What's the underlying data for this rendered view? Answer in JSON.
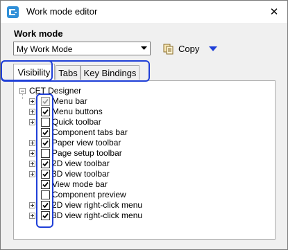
{
  "window": {
    "title": "Work mode editor",
    "close_glyph": "✕"
  },
  "work_mode": {
    "label": "Work mode",
    "selected": "My Work Mode",
    "copy_label": "Copy"
  },
  "tabs": [
    {
      "label": "Visibility",
      "active": true
    },
    {
      "label": "Tabs",
      "active": false
    },
    {
      "label": "Key Bindings",
      "active": false
    }
  ],
  "tree": {
    "root": "CET Designer",
    "items": [
      {
        "label": "Menu bar",
        "expander": true,
        "checked": true,
        "grayed": true
      },
      {
        "label": "Menu buttons",
        "expander": true,
        "checked": true,
        "grayed": false
      },
      {
        "label": "Quick toolbar",
        "expander": true,
        "checked": false,
        "grayed": false
      },
      {
        "label": "Component tabs bar",
        "expander": false,
        "checked": true,
        "grayed": false
      },
      {
        "label": "Paper view toolbar",
        "expander": true,
        "checked": true,
        "grayed": false
      },
      {
        "label": "Page setup toolbar",
        "expander": true,
        "checked": false,
        "grayed": false
      },
      {
        "label": "2D view toolbar",
        "expander": true,
        "checked": true,
        "grayed": false
      },
      {
        "label": "3D view toolbar",
        "expander": true,
        "checked": true,
        "grayed": false
      },
      {
        "label": "View mode bar",
        "expander": false,
        "checked": true,
        "grayed": false
      },
      {
        "label": "Component preview",
        "expander": false,
        "checked": false,
        "grayed": false
      },
      {
        "label": "2D view right-click menu",
        "expander": true,
        "checked": true,
        "grayed": false
      },
      {
        "label": "3D view right-click menu",
        "expander": true,
        "checked": true,
        "grayed": false
      }
    ]
  },
  "colors": {
    "highlight": "#1f3fd8",
    "app_icon": "#2f8fd8",
    "dropdown_arrow": "#1f3fd8"
  }
}
